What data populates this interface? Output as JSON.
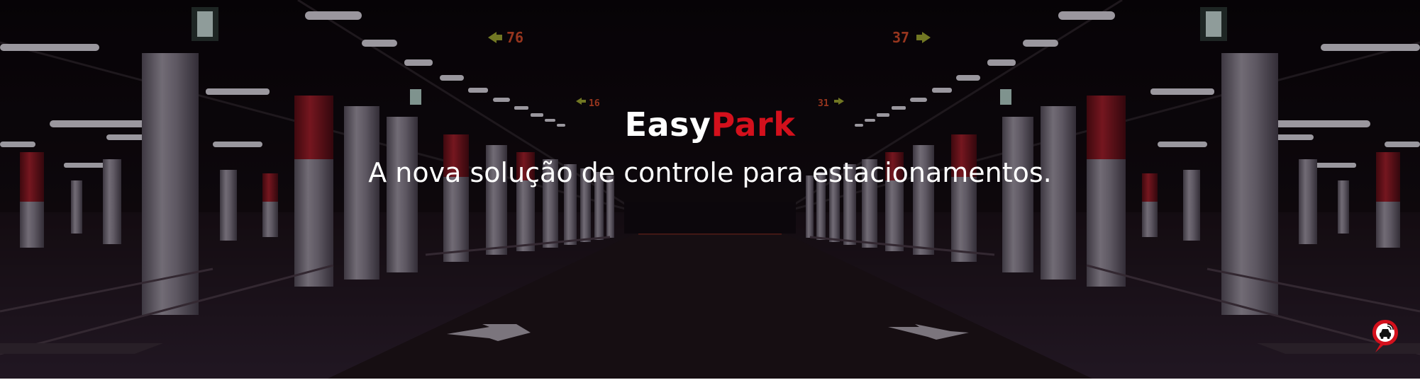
{
  "brand": {
    "name_part1": "Easy",
    "name_part2": "Park",
    "accent_color": "#d3101c"
  },
  "hero": {
    "tagline": "A nova solução de controle para estacionamentos."
  },
  "signs": [
    {
      "label": "76"
    },
    {
      "label": "37"
    },
    {
      "label": "16"
    },
    {
      "label": "31"
    }
  ],
  "chat_widget": {
    "icon": "car-wifi-pin-icon"
  }
}
